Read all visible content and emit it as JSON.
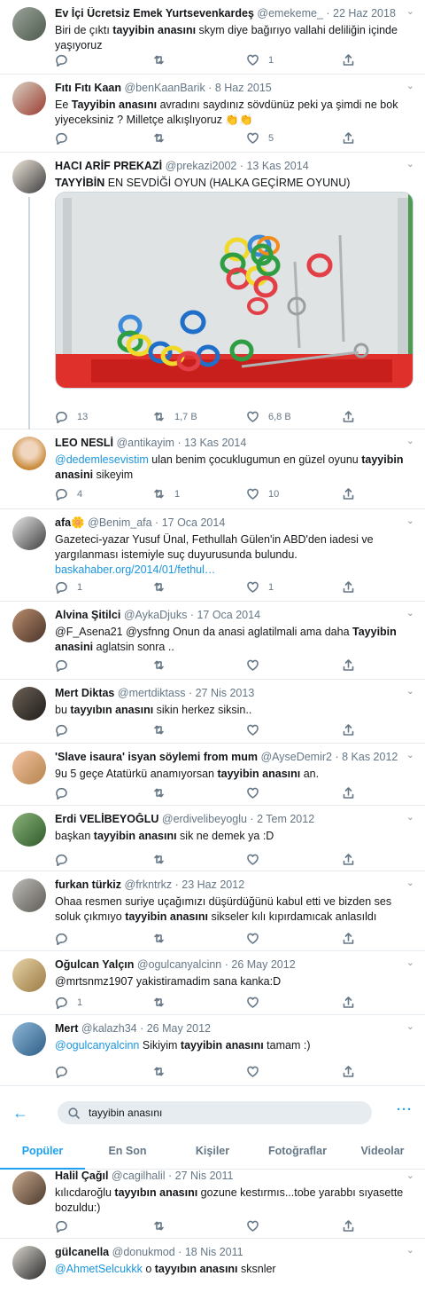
{
  "tweets": [
    {
      "name": "Ev İçi Ücretsiz Emek Yurtsevenkardeş",
      "handle": "@emekeme_",
      "date": "22 Haz 2018",
      "t1": "Biri de çıktı ",
      "t2": "tayyibin anasını",
      "t3": " skym diye bağırıyo vallahi deliliğin içinde yaşıyoruz",
      "reply": "",
      "rt": "",
      "like": "1"
    },
    {
      "name": "Fıtı Fıtı Kaan",
      "handle": "@benKaanBarik",
      "date": "8 Haz 2015",
      "t1": "Ee ",
      "t2": "Tayyibin anasını",
      "t3": " avradını saydınız sövdünüz peki ya şimdi ne bok yiyeceksiniz ? Milletçe alkışlıyoruz 👏👏",
      "reply": "",
      "rt": "",
      "like": "5"
    },
    {
      "name": "HACI ARİF PREKAZİ",
      "handle": "@prekazi2002",
      "date": "13 Kas 2014",
      "t1": "",
      "t2": "TAYYİBİN",
      "t3": " EN SEVDİĞİ OYUN (HALKA GEÇİRME OYUNU)",
      "reply": "13",
      "rt": "1,7 B",
      "like": "6,8 B"
    },
    {
      "name": "LEO NESLİ",
      "handle": "@antikayim",
      "date": "13 Kas 2014",
      "link": "@dedemlesevistim",
      "t1": " ulan benim çocuklugumun en güzel oyunu ",
      "t2": "tayyibin anasini",
      "t3": " sikeyim",
      "reply": "4",
      "rt": "1",
      "like": "10"
    },
    {
      "name": "afa🌼",
      "handle": "@Benim_afa",
      "date": "17 Oca 2014",
      "t1": "Gazeteci-yazar Yusuf Ünal, Fethullah Gülen'in ABD'den iadesi ve yargılanması istemiyle suç duyurusunda bulundu.",
      "url": "baskahaber.org/2014/01/fethul…",
      "reply": "1",
      "rt": "",
      "like": "1"
    },
    {
      "name": "Alvina Şitilci",
      "handle": "@AykaDjuks",
      "date": "17 Oca 2014",
      "t1": "@F_Asena21 @ysfnng Onun da anasi aglatilmali ama daha ",
      "t2": "Tayyibin anasini",
      "t3": " aglatsin sonra ..",
      "reply": "",
      "rt": "",
      "like": ""
    },
    {
      "name": "Mert Diktas",
      "handle": "@mertdiktass",
      "date": "27 Nis 2013",
      "t1": "bu ",
      "t2": "tayyıbın anasını",
      "t3": " sikin herkez siksin..",
      "reply": "",
      "rt": "",
      "like": ""
    },
    {
      "name": "'Slave isaura' isyan söylemi from mum",
      "handle": "@AyseDemir2",
      "date": "8 Kas 2012",
      "t1": "9u 5 geçe Atatürkü anamıyorsan ",
      "t2": "tayyibin anasını",
      "t3": " an.",
      "reply": "",
      "rt": "",
      "like": ""
    },
    {
      "name": "Erdi VELİBEYOĞLU",
      "handle": "@erdivelibeyoglu",
      "date": "2 Tem 2012",
      "t1": "başkan ",
      "t2": "tayyibin anasını",
      "t3": " sik ne demek ya :D",
      "reply": "",
      "rt": "",
      "like": ""
    },
    {
      "name": "furkan türkiz",
      "handle": "@frkntrkz",
      "date": "23 Haz 2012",
      "t1": "Ohaa resmen suriye uçağımızı düşürdüğünü kabul etti ve bizden ses soluk çıkmıyo ",
      "t2": "tayyibin anasını",
      "t3": " sikseler kılı kıpırdamıcak anlasıldı",
      "reply": "",
      "rt": "",
      "like": ""
    },
    {
      "name": "Oğulcan Yalçın",
      "handle": "@ogulcanyalcinn",
      "date": "26 May 2012",
      "t1": "@mrtsnmz1907 yakistiramadim sana kanka:D",
      "reply": "1",
      "rt": "",
      "like": ""
    },
    {
      "name": "Mert",
      "handle": "@kalazh34",
      "date": "26 May 2012",
      "link": "@ogulcanyalcinn",
      "t1": " Sikiyim ",
      "t2": "tayyibin anasını",
      "t3": " tamam :)",
      "reply": "",
      "rt": "",
      "like": ""
    },
    {
      "name": "Halil Çağıl",
      "handle": "@cagilhalil",
      "date": "27 Nis 2011",
      "t1": "kılıcdaroğlu ",
      "t2": "tayyıbın anasını",
      "t3": " gozune kestırmıs...tobe yarabbı sıyasette bozuldu:)",
      "reply": "",
      "rt": "",
      "like": ""
    },
    {
      "name": "gülcanella",
      "handle": "@donukmod",
      "date": "18 Nis 2011",
      "link": "@AhmetSelcukkk",
      "t1": "  o ",
      "t2": "tayyıbın anasını",
      "t3": " sksnler",
      "reply": "",
      "rt": "",
      "like": ""
    }
  ],
  "header": {
    "search_query": "tayyibin anasını",
    "tabs": [
      "Popüler",
      "En Son",
      "Kişiler",
      "Fotoğraflar",
      "Videolar"
    ]
  },
  "colors": {
    "accent": "#1da1f2",
    "link": "#1b95e0",
    "muted": "#657786",
    "divider": "#e6ecf0"
  }
}
